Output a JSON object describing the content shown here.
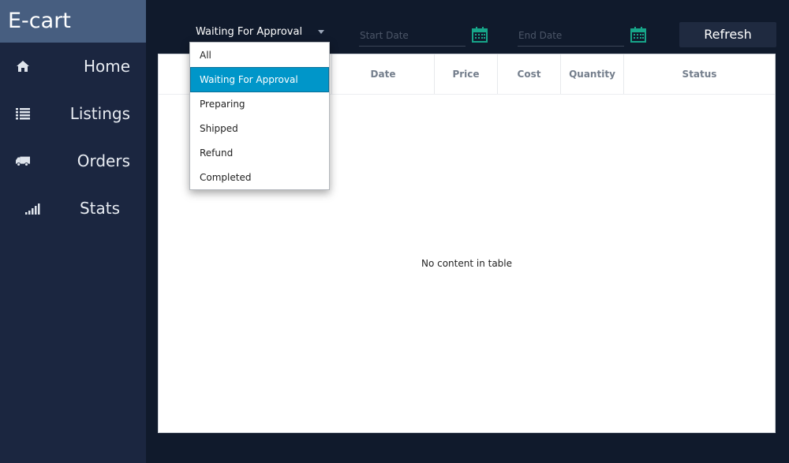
{
  "app": {
    "title": "E-cart"
  },
  "sidebar": {
    "items": [
      {
        "label": "Home",
        "icon": "home-icon"
      },
      {
        "label": "Listings",
        "icon": "list-icon"
      },
      {
        "label": "Orders",
        "icon": "truck-icon"
      },
      {
        "label": "Stats",
        "icon": "signal-bars-icon"
      }
    ]
  },
  "filter": {
    "selected": "Waiting For Approval",
    "options": [
      "All",
      "Waiting For Approval",
      "Preparing",
      "Shipped",
      "Refund",
      "Completed"
    ]
  },
  "start_date": {
    "placeholder": "Start Date"
  },
  "end_date": {
    "placeholder": "End Date"
  },
  "toolbar": {
    "refresh_label": "Refresh"
  },
  "table": {
    "columns": [
      "",
      "Date",
      "Price",
      "Cost",
      "Quantity",
      "Status"
    ],
    "empty_message": "No content in table"
  },
  "colors": {
    "sidebar": "#1b2640",
    "brand": "#475e80",
    "background": "#101a2c",
    "accent": "#0096c9",
    "calendar": "#17a589"
  }
}
